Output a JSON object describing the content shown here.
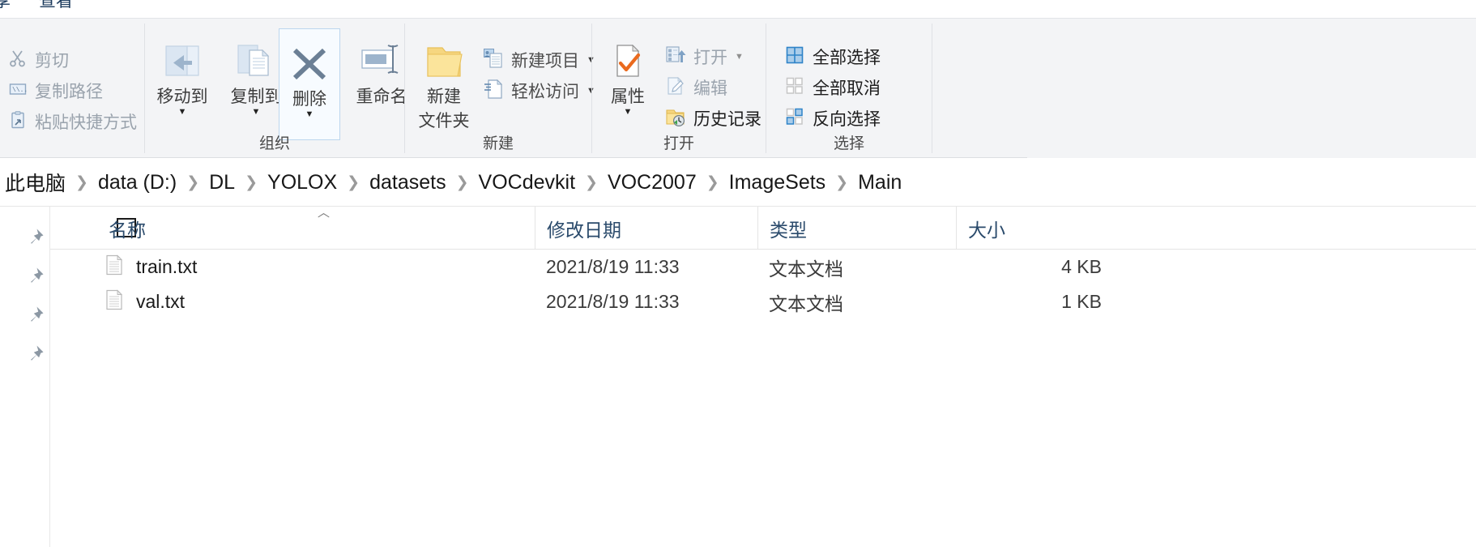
{
  "window": {
    "tabs_clipped": [
      "享",
      "查看"
    ]
  },
  "ribbon": {
    "groups": [
      {
        "name": "clipboard",
        "label": "",
        "small_commands": [
          {
            "icon": "scissors-icon",
            "label": "剪切",
            "dim": true
          },
          {
            "icon": "copy-path-icon",
            "label": "复制路径",
            "dim": true
          },
          {
            "icon": "paste-shortcut-icon",
            "label": "粘贴快捷方式",
            "dim": true
          }
        ]
      },
      {
        "name": "organize",
        "label": "组织",
        "big_commands": [
          {
            "icon": "move-to-icon",
            "label": "移动到",
            "caret": true
          },
          {
            "icon": "copy-to-icon",
            "label": "复制到",
            "caret": true
          },
          {
            "icon": "delete-icon",
            "label": "删除",
            "caret": true,
            "selected": true
          },
          {
            "icon": "rename-icon",
            "label": "重命名",
            "caret": false
          }
        ]
      },
      {
        "name": "new",
        "label": "新建",
        "big_commands": [
          {
            "icon": "new-folder-icon",
            "label_line1": "新建",
            "label_line2": "文件夹"
          }
        ],
        "small_commands": [
          {
            "icon": "new-item-icon",
            "label": "新建项目",
            "caret": true
          },
          {
            "icon": "easy-access-icon",
            "label": "轻松访问",
            "caret": true
          }
        ]
      },
      {
        "name": "open",
        "label": "打开",
        "big_commands": [
          {
            "icon": "properties-icon",
            "label": "属性",
            "caret": true
          }
        ],
        "small_commands": [
          {
            "icon": "open-icon",
            "label": "打开",
            "caret": true,
            "dim": true
          },
          {
            "icon": "edit-icon",
            "label": "编辑",
            "dim": true
          },
          {
            "icon": "history-icon",
            "label": "历史记录",
            "dim": false
          }
        ]
      },
      {
        "name": "select",
        "label": "选择",
        "small_commands": [
          {
            "icon": "select-all-icon",
            "label": "全部选择"
          },
          {
            "icon": "select-none-icon",
            "label": "全部取消"
          },
          {
            "icon": "invert-selection-icon",
            "label": "反向选择"
          }
        ]
      }
    ]
  },
  "address": {
    "crumbs": [
      "此电脑",
      "data (D:)",
      "DL",
      "YOLOX",
      "datasets",
      "VOCdevkit",
      "VOC2007",
      "ImageSets",
      "Main"
    ],
    "separator": "❯"
  },
  "navpane": {
    "pin_count": 4,
    "pin_icon": "pin-icon"
  },
  "filelist": {
    "columns": [
      {
        "key": "name",
        "label": "名称",
        "sort": "asc"
      },
      {
        "key": "date",
        "label": "修改日期"
      },
      {
        "key": "type",
        "label": "类型"
      },
      {
        "key": "size",
        "label": "大小"
      }
    ],
    "rows": [
      {
        "icon": "text-file-icon",
        "name": "train.txt",
        "date": "2021/8/19 11:33",
        "type": "文本文档",
        "size": "4 KB"
      },
      {
        "icon": "text-file-icon",
        "name": "val.txt",
        "date": "2021/8/19 11:33",
        "type": "文本文档",
        "size": "1 KB"
      }
    ]
  },
  "colors": {
    "ribbon_bg": "#f3f4f6",
    "header_text": "#2a4a6b",
    "accent_blue": "#4a90d9",
    "folder_yellow": "#fcd462",
    "check_orange": "#e8731c",
    "selected_border": "#bcd6ee"
  }
}
